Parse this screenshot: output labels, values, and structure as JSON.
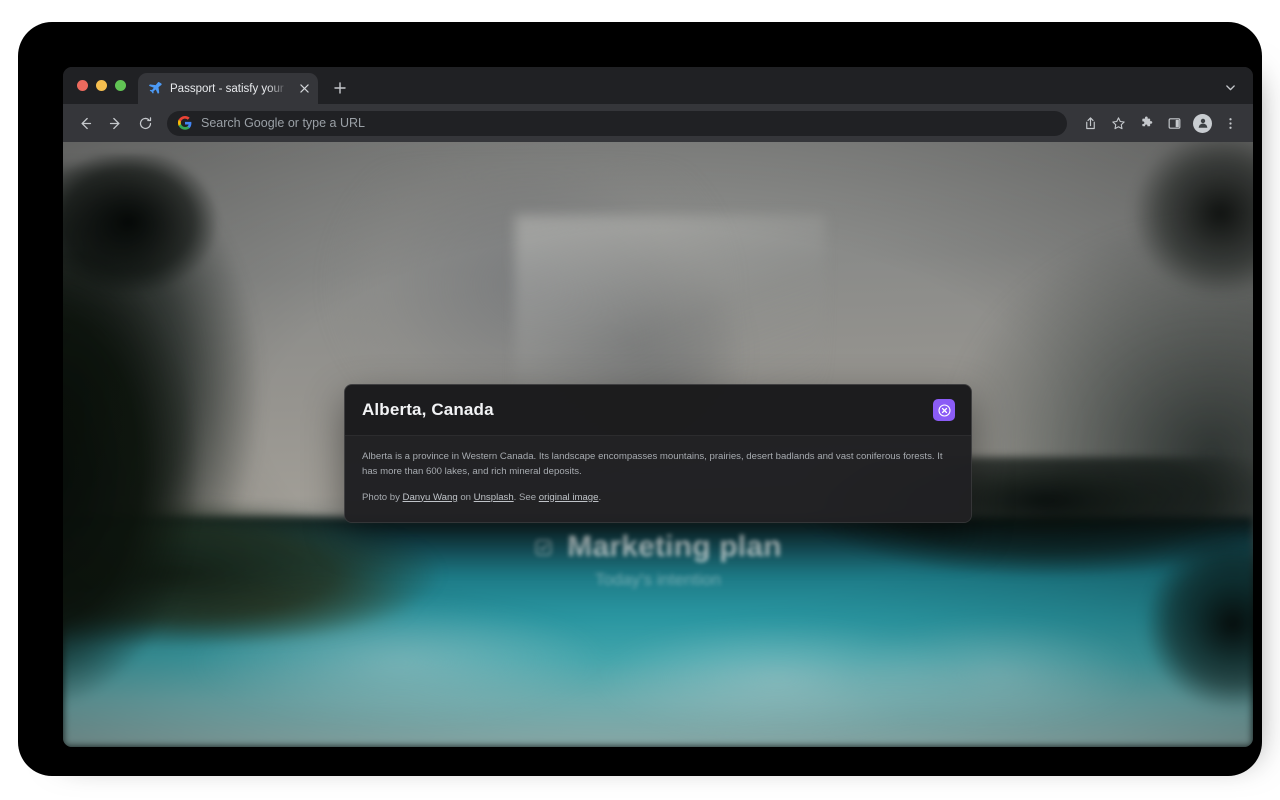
{
  "browser": {
    "window_controls": [
      {
        "name": "close",
        "color": "#ED6A5E"
      },
      {
        "name": "minimize",
        "color": "#F5BE4F"
      },
      {
        "name": "maximize",
        "color": "#61C454"
      }
    ],
    "tab": {
      "title": "Passport - satisfy your wanderlust",
      "favicon": "airplane-icon",
      "close_label": "×"
    },
    "new_tab_label": "+",
    "tab_search_icon": "chevron-down-icon",
    "nav": {
      "back_icon": "arrow-left-icon",
      "forward_icon": "arrow-right-icon",
      "reload_icon": "reload-icon"
    },
    "omnibox": {
      "icon": "google-g-icon",
      "value": "",
      "placeholder": "Search Google or type a URL"
    },
    "toolbar_actions": [
      {
        "name": "share-icon",
        "label": "Share"
      },
      {
        "name": "bookmark-star-icon",
        "label": "Bookmark this tab"
      },
      {
        "name": "extensions-puzzle-icon",
        "label": "Extensions"
      },
      {
        "name": "side-panel-icon",
        "label": "Side panel"
      },
      {
        "name": "profile-avatar-icon",
        "label": "Profile"
      },
      {
        "name": "more-menu-icon",
        "label": "Customize and control Google Chrome"
      }
    ]
  },
  "page": {
    "widget": {
      "icon": "checklist-icon",
      "title": "Marketing plan",
      "subtitle": "Today's intention"
    },
    "info_card": {
      "title": "Alberta, Canada",
      "description": "Alberta is a province in Western Canada. Its landscape encompasses mountains, prairies, desert badlands and vast coniferous forests. It has more than 600 lakes, and rich mineral deposits.",
      "attribution": {
        "prefix": "Photo by ",
        "photographer": "Danyu Wang",
        "middle": " on ",
        "source": "Unsplash",
        "suffix_before_link": ". See ",
        "original_link": "original image",
        "end": "."
      },
      "close_button": {
        "icon": "close-circle-icon",
        "label": "Close",
        "color": "#8B5CF6"
      }
    }
  }
}
